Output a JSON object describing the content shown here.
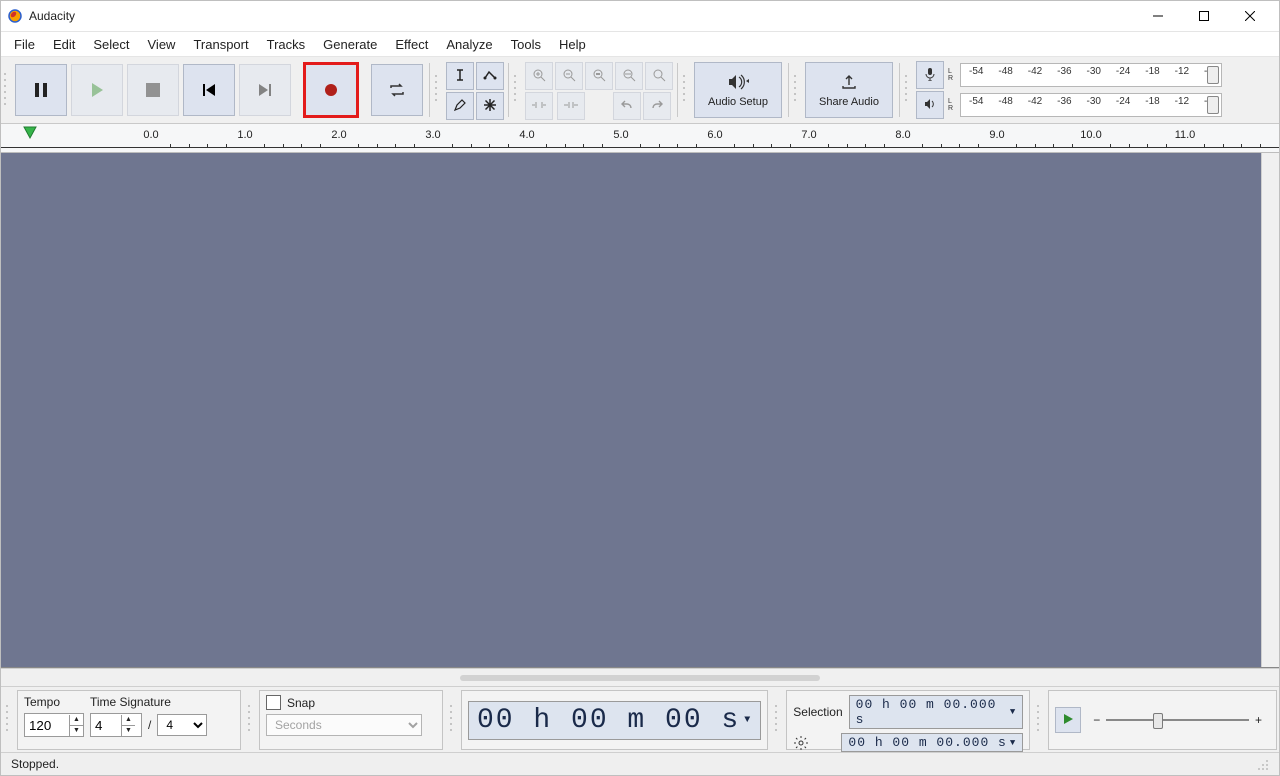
{
  "title": "Audacity",
  "menu": [
    "File",
    "Edit",
    "Select",
    "View",
    "Transport",
    "Tracks",
    "Generate",
    "Effect",
    "Analyze",
    "Tools",
    "Help"
  ],
  "transport": {
    "pause": "Pause",
    "play": "Play",
    "stop": "Stop",
    "skip_start": "Skip to Start",
    "skip_end": "Skip to End",
    "record": "Record",
    "loop": "Enable Looping"
  },
  "tools": {
    "selection": "Selection",
    "envelope": "Envelope",
    "draw": "Draw",
    "multi": "Multi"
  },
  "zoom": {
    "in": "Zoom In",
    "out": "Zoom Out",
    "fitsel": "Fit Selection",
    "fitproj": "Fit Project",
    "toggle": "Zoom Toggle"
  },
  "trim": {
    "trim": "Trim",
    "silence": "Silence"
  },
  "history": {
    "undo": "Undo",
    "redo": "Redo"
  },
  "audio_setup": "Audio Setup",
  "share_audio": "Share Audio",
  "meter_ticks": [
    "-54",
    "-48",
    "-42",
    "-36",
    "-30",
    "-24",
    "-18",
    "-12",
    "-6"
  ],
  "meter_lr": {
    "l": "L",
    "r": "R"
  },
  "timeline_marks": [
    "0.0",
    "1.0",
    "2.0",
    "3.0",
    "4.0",
    "5.0",
    "6.0",
    "7.0",
    "8.0",
    "9.0",
    "10.0",
    "11.0"
  ],
  "tempo": {
    "label": "Tempo",
    "value": "120"
  },
  "timesig": {
    "label": "Time Signature",
    "num": "4",
    "den": "4",
    "sep": "/"
  },
  "snap": {
    "label": "Snap",
    "unit": "Seconds"
  },
  "time_display": "00 h 00 m 00 s",
  "selection": {
    "label": "Selection",
    "start": "00 h 00 m 00.000 s",
    "end": "00 h 00 m 00.000 s"
  },
  "speed": {
    "minus": "−",
    "plus": "+"
  },
  "status": "Stopped."
}
